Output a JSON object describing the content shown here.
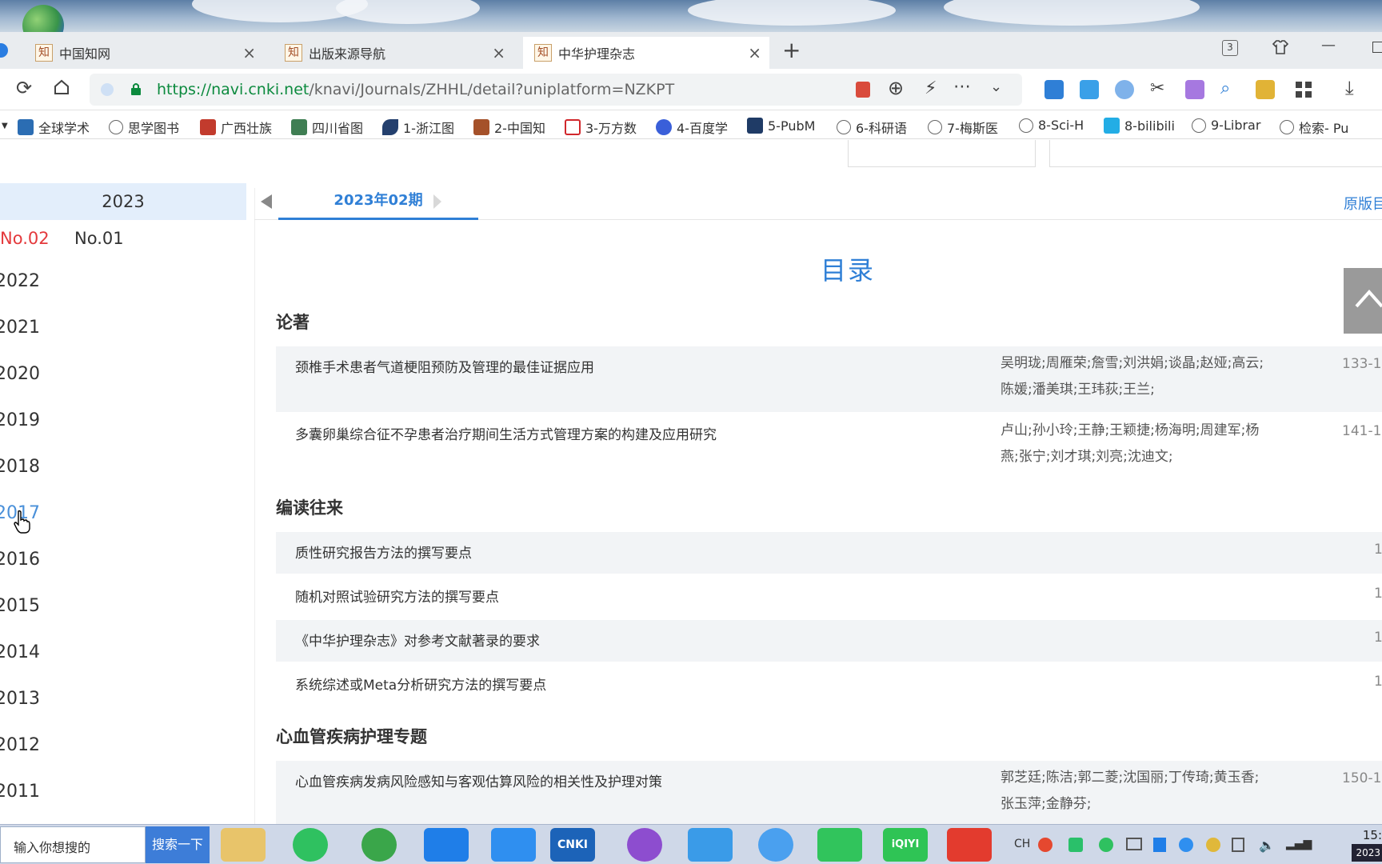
{
  "browser": {
    "tabs": [
      {
        "label": "中国知网",
        "favicon": "知",
        "active": false
      },
      {
        "label": "出版来源导航",
        "favicon": "知",
        "active": false
      },
      {
        "label": "中华护理杂志",
        "favicon": "知",
        "active": true
      }
    ],
    "tab_count": "3",
    "url_host": "https://navi.cnki.net",
    "url_path": "/knavi/Journals/ZHHL/detail?uniplatform=NZKPT"
  },
  "bookmarks": [
    {
      "label": "全球学术",
      "icon": "cnki-icon"
    },
    {
      "label": "思学图书",
      "icon": "globe-icon"
    },
    {
      "label": "广西壮族",
      "icon": "library-icon"
    },
    {
      "label": "四川省图",
      "icon": "library-icon"
    },
    {
      "label": "1-浙江图",
      "icon": "bird-icon"
    },
    {
      "label": "2-中国知",
      "icon": "cnki-icon"
    },
    {
      "label": "3-万方数",
      "icon": "wanfang-icon"
    },
    {
      "label": "4-百度学",
      "icon": "baidu-icon"
    },
    {
      "label": "5-PubM",
      "icon": "pubmed-icon"
    },
    {
      "label": "6-科研语",
      "icon": "globe-icon"
    },
    {
      "label": "7-梅斯医",
      "icon": "globe-icon"
    },
    {
      "label": "8-Sci-H",
      "icon": "globe-icon"
    },
    {
      "label": "8-bilibili",
      "icon": "bilibili-icon"
    },
    {
      "label": "9-Librar",
      "icon": "globe-icon"
    },
    {
      "label": "检索- Pu",
      "icon": "globe-icon"
    }
  ],
  "sidebar": {
    "current_year": "2023",
    "issues": [
      {
        "label": "No.02",
        "selected": true
      },
      {
        "label": "No.01",
        "selected": false
      }
    ],
    "years": [
      "2022",
      "2021",
      "2020",
      "2019",
      "2018",
      "2017",
      "2016",
      "2015",
      "2014",
      "2013",
      "2012",
      "2011"
    ],
    "hovered_year": "2017"
  },
  "issue_bar": {
    "current_issue": "2023年02期",
    "original_link": "原版目"
  },
  "toc": {
    "title": "目录",
    "sections": [
      {
        "name": "论著",
        "articles": [
          {
            "title": "颈椎手术患者气道梗阻预防及管理的最佳证据应用",
            "authors": "吴明珑;周雁荣;詹雪;刘洪娟;谈晶;赵娅;高云;陈媛;潘美琪;王玮荻;王兰;",
            "pages": "133-1"
          },
          {
            "title": "多囊卵巢综合征不孕患者治疗期间生活方式管理方案的构建及应用研究",
            "authors": "卢山;孙小玲;王静;王颖捷;杨海明;周建军;杨燕;张宁;刘才琪;刘亮;沈迪文;",
            "pages": "141-1"
          }
        ]
      },
      {
        "name": "编读往来",
        "articles": [
          {
            "title": "质性研究报告方法的撰写要点",
            "authors": "",
            "pages": "1"
          },
          {
            "title": "随机对照试验研究方法的撰写要点",
            "authors": "",
            "pages": "1"
          },
          {
            "title": "《中华护理杂志》对参考文献著录的要求",
            "authors": "",
            "pages": "1"
          },
          {
            "title": "系统综述或Meta分析研究方法的撰写要点",
            "authors": "",
            "pages": "1"
          }
        ]
      },
      {
        "name": "心血管疾病护理专题",
        "articles": [
          {
            "title": "心血管疾病发病风险感知与客观估算风险的相关性及护理对策",
            "authors": "郭芝廷;陈洁;郭二菱;沈国丽;丁传琦;黄玉香;张玉萍;金静芬;",
            "pages": "150-1"
          }
        ]
      }
    ]
  },
  "taskbar": {
    "search_placeholder": "输入你想搜的",
    "search_button": "搜索一下",
    "tray_lang": "CH",
    "clock_time": "15:",
    "clock_date": "2023"
  },
  "colors": {
    "accent": "#2f7fd6",
    "selected_issue": "#e4393c",
    "row_shade": "#f2f4f6"
  }
}
